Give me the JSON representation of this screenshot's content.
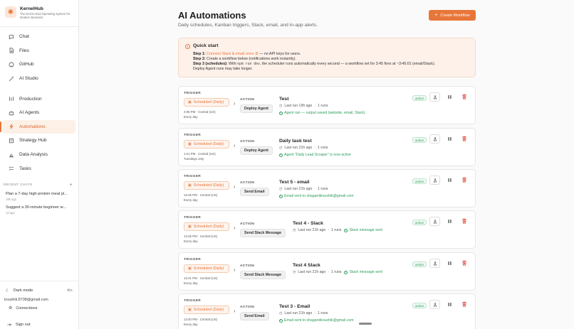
{
  "brand": {
    "name": "KernelHub",
    "tagline": "The End-to-End Operating System for Modern Business",
    "logo_icon": "sparkle-icon",
    "accent": "#e8763a"
  },
  "nav": [
    {
      "label": "Chat",
      "icon": "chat-bubble-icon",
      "key": "chat"
    },
    {
      "label": "Files",
      "icon": "file-icon",
      "key": "files"
    },
    {
      "label": "GitHub",
      "icon": "github-icon",
      "key": "github"
    },
    {
      "label": "AI Studio",
      "icon": "magic-wand-icon",
      "key": "ai-studio"
    },
    {
      "label": "Production",
      "icon": "production-icon",
      "key": "production"
    },
    {
      "label": "AI Agents",
      "icon": "robot-icon",
      "key": "ai-agents"
    },
    {
      "label": "Automations",
      "icon": "lightning-icon",
      "key": "automations",
      "active": true
    },
    {
      "label": "Strategy Hub",
      "icon": "building-icon",
      "key": "strategy-hub"
    },
    {
      "label": "Data Analysis",
      "icon": "bar-chart-icon",
      "key": "data-analysis"
    },
    {
      "label": "Tasks",
      "icon": "checklist-icon",
      "key": "tasks"
    }
  ],
  "recent": {
    "heading": "RECENT CHATS",
    "items": [
      {
        "title": "Plan a 7-day high-protein meal pl...",
        "time": "19h ago"
      },
      {
        "title": "Suggest a 30-minute beginner w...",
        "time": "1d ago"
      }
    ]
  },
  "footer": {
    "dark_mode": "Dark mode",
    "shortcut": "⌘K",
    "email": "koushik.8738@gmail.com",
    "connections": "Connections",
    "sign_out": "Sign out"
  },
  "page": {
    "title": "AI Automations",
    "subtitle": "Daily schedules, Kanban triggers, Slack, email, and in-app alerts.",
    "create_label": "Create Workflow"
  },
  "quickstart": {
    "title": "Quick start",
    "step1_prefix": "Step 1:",
    "step1_link": "Connect Slack & email once ⚙",
    "step1_rest": " — no API keys for users.",
    "step2_prefix": "Step 2:",
    "step2_text": " Create a workflow below (notifications work instantly).",
    "step3_prefix": "Step 3 (schedules):",
    "step3_a": " With ",
    "step3_code": "npm run dev",
    "step3_b": ", the scheduler runs automatically every second — a workflow set for 3:45 fires at ~3:45:01 (email/Slack).",
    "step3_c": "Deploy Agent runs may take longer."
  },
  "labels": {
    "trigger": "TRIGGER",
    "action": "ACTION"
  },
  "workflows": [
    {
      "trigger": "Scheduled (Daily)",
      "time": "4:05 PM · Central (US)",
      "freq": "Every day",
      "action": "Deploy Agent",
      "name": "Test",
      "last_run": "Last run 19h ago",
      "runs": "1 runs",
      "result": "Agent ran — output saved (website, email, Slack)",
      "status": "active"
    },
    {
      "trigger": "Scheduled (Daily)",
      "time": "1:21 PM · Central (US)",
      "freq": "Tuesdays only",
      "action": "Deploy Agent",
      "name": "Daily task test",
      "last_run": "Last run 21h ago",
      "runs": "1 runs",
      "result": "Agent \"Daily Lead Scraper\" is now active",
      "status": "active"
    },
    {
      "trigger": "Scheduled (Daily)",
      "time": "12:46 PM · Central (US)",
      "freq": "Every day",
      "action": "Send Email",
      "name": "Test 5 - email",
      "last_run": "Last run 21h ago",
      "runs": "1 runs",
      "result": "Email sent to shagantikoushik@gmail.com",
      "status": "active"
    },
    {
      "trigger": "Scheduled (Daily)",
      "time": "12:45 PM · Central (US)",
      "freq": "Every day",
      "action": "Send Slack Message",
      "name": "Test 4 - Slack",
      "last_run": "Last run 21h ago",
      "runs": "1 runs",
      "result": "Slack message sent",
      "status": "active"
    },
    {
      "trigger": "Scheduled (Daily)",
      "time": "12:41 PM · Central (US)",
      "freq": "Every day",
      "action": "Send Slack Message",
      "name": "Test 4 Slack",
      "last_run": "Last run 21h ago",
      "runs": "1 runs",
      "result": "Slack message sent",
      "status": "active"
    },
    {
      "trigger": "Scheduled (Daily)",
      "time": "12:40 PM · Central (US)",
      "freq": "Every day",
      "action": "Send Email",
      "name": "Test 3 - Email",
      "last_run": "Last run 21h ago",
      "runs": "1 runs",
      "result": "Email sent to shagantikoushik@gmail.com",
      "status": "active"
    }
  ]
}
